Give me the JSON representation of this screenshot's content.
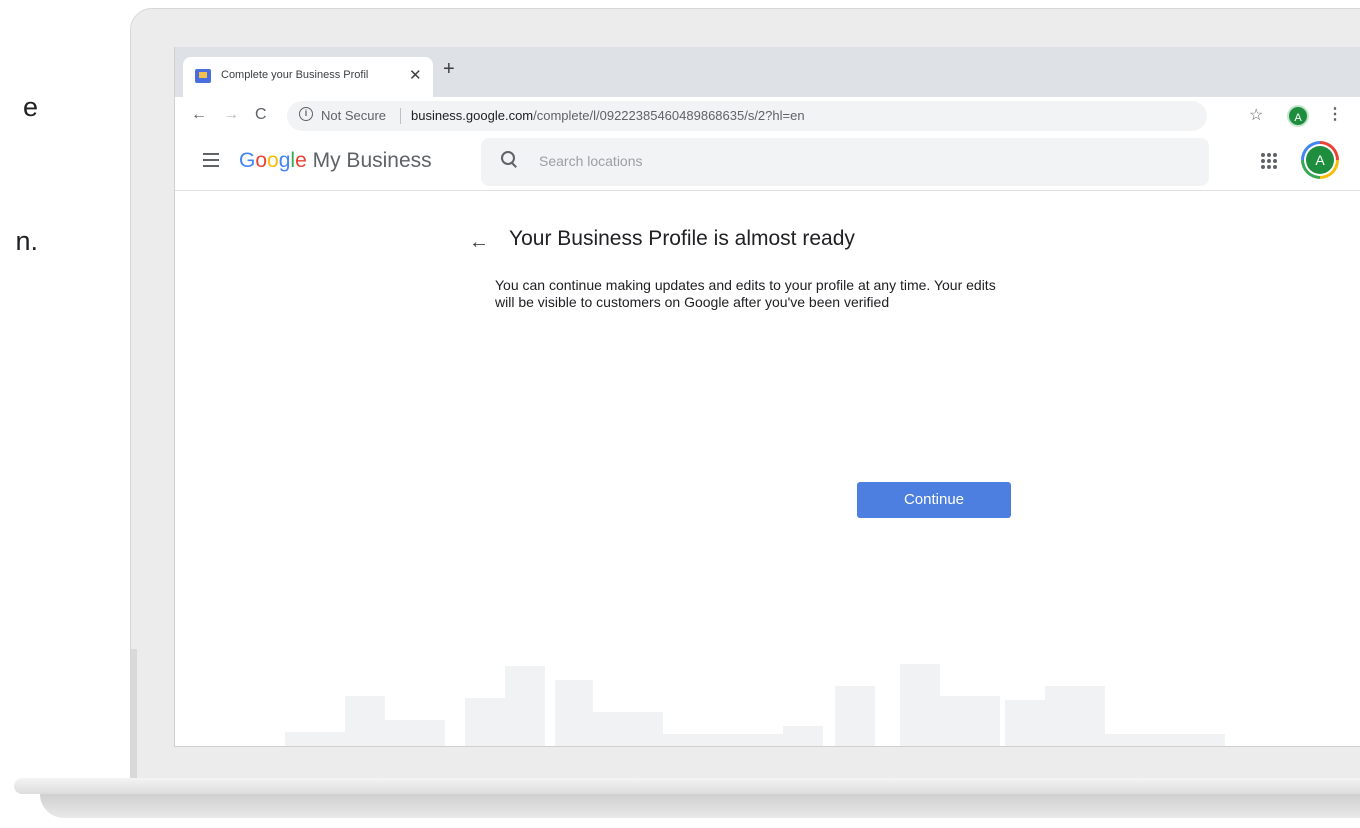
{
  "side_text": {
    "line1": "e",
    "line2": "n."
  },
  "browser": {
    "tab_title": "Complete your Business Profil",
    "tab_close": "✕",
    "new_tab": "+",
    "not_secure": "Not Secure",
    "url_domain": "business.google.com",
    "url_path": "/complete/l/09222385460489868635/s/2?hl=en",
    "profile_initial": "A"
  },
  "app": {
    "logo": {
      "G": "G",
      "o1": "o",
      "o2": "o",
      "g": "g",
      "l": "l",
      "e": "e",
      "product": "My Business"
    },
    "search_placeholder": "Search locations",
    "profile_initial": "A"
  },
  "content": {
    "title": "Your Business Profile is almost ready",
    "description": "You can continue making updates and edits to your profile at any time. Your edits will be visible to customers on Google after you've been verified",
    "continue_label": "Continue"
  },
  "colors": {
    "accent": "#4d7fe0",
    "avatar": "#1e8e3e"
  }
}
